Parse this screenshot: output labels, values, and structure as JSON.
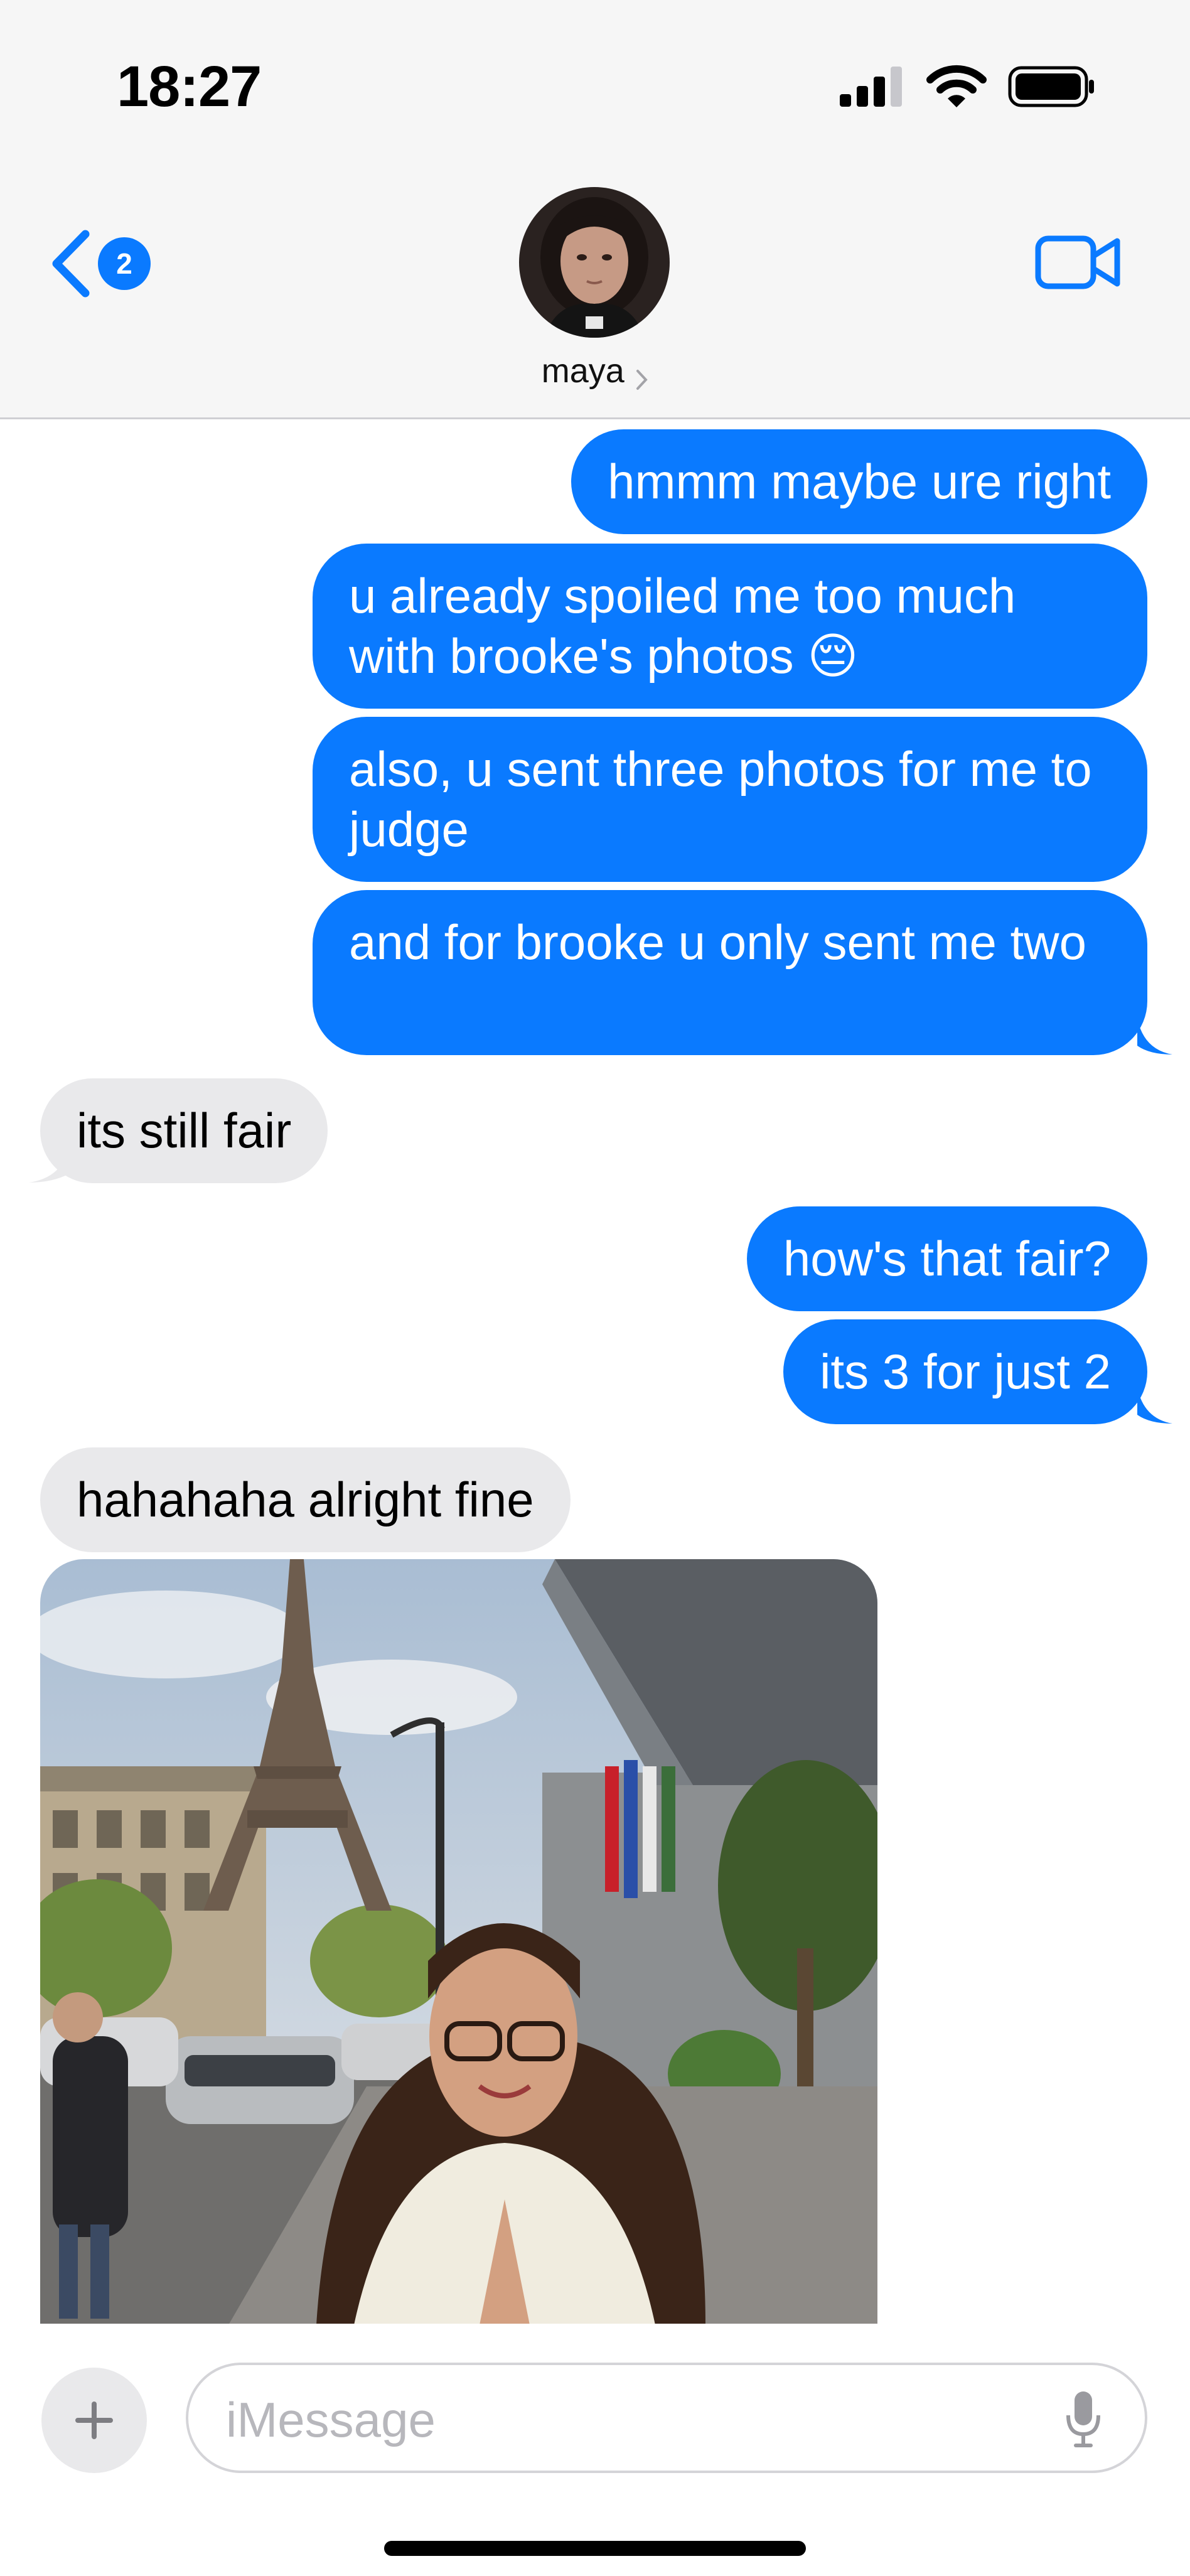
{
  "status_bar": {
    "time": "18:27",
    "icons": [
      "cellular-signal-icon",
      "wifi-icon",
      "battery-icon"
    ]
  },
  "header": {
    "back_badge_count": "2",
    "contact_name": "maya",
    "icons": [
      "back-chevron-icon",
      "chevron-right-icon",
      "video-camera-icon"
    ]
  },
  "messages": [
    {
      "direction": "outgoing",
      "text": "hmmm maybe ure right"
    },
    {
      "direction": "outgoing",
      "text": "u already spoiled me too much with brooke's photos 😔"
    },
    {
      "direction": "outgoing",
      "text": "also, u sent three photos for me to judge"
    },
    {
      "direction": "outgoing",
      "text": "and for brooke u only sent me two"
    },
    {
      "direction": "incoming",
      "text": "its still fair"
    },
    {
      "direction": "outgoing",
      "text": "how's that fair?"
    },
    {
      "direction": "outgoing",
      "text": "its 3 for just 2"
    },
    {
      "direction": "incoming",
      "text": "hahahaha alright fine"
    },
    {
      "direction": "incoming",
      "type": "photo"
    }
  ],
  "composer": {
    "placeholder": "iMessage",
    "icons": [
      "plus-icon",
      "microphone-icon"
    ]
  },
  "colors": {
    "outgoing_bubble": "#0a7aff",
    "incoming_bubble": "#e9e9eb",
    "header_background": "#f6f6f6"
  }
}
